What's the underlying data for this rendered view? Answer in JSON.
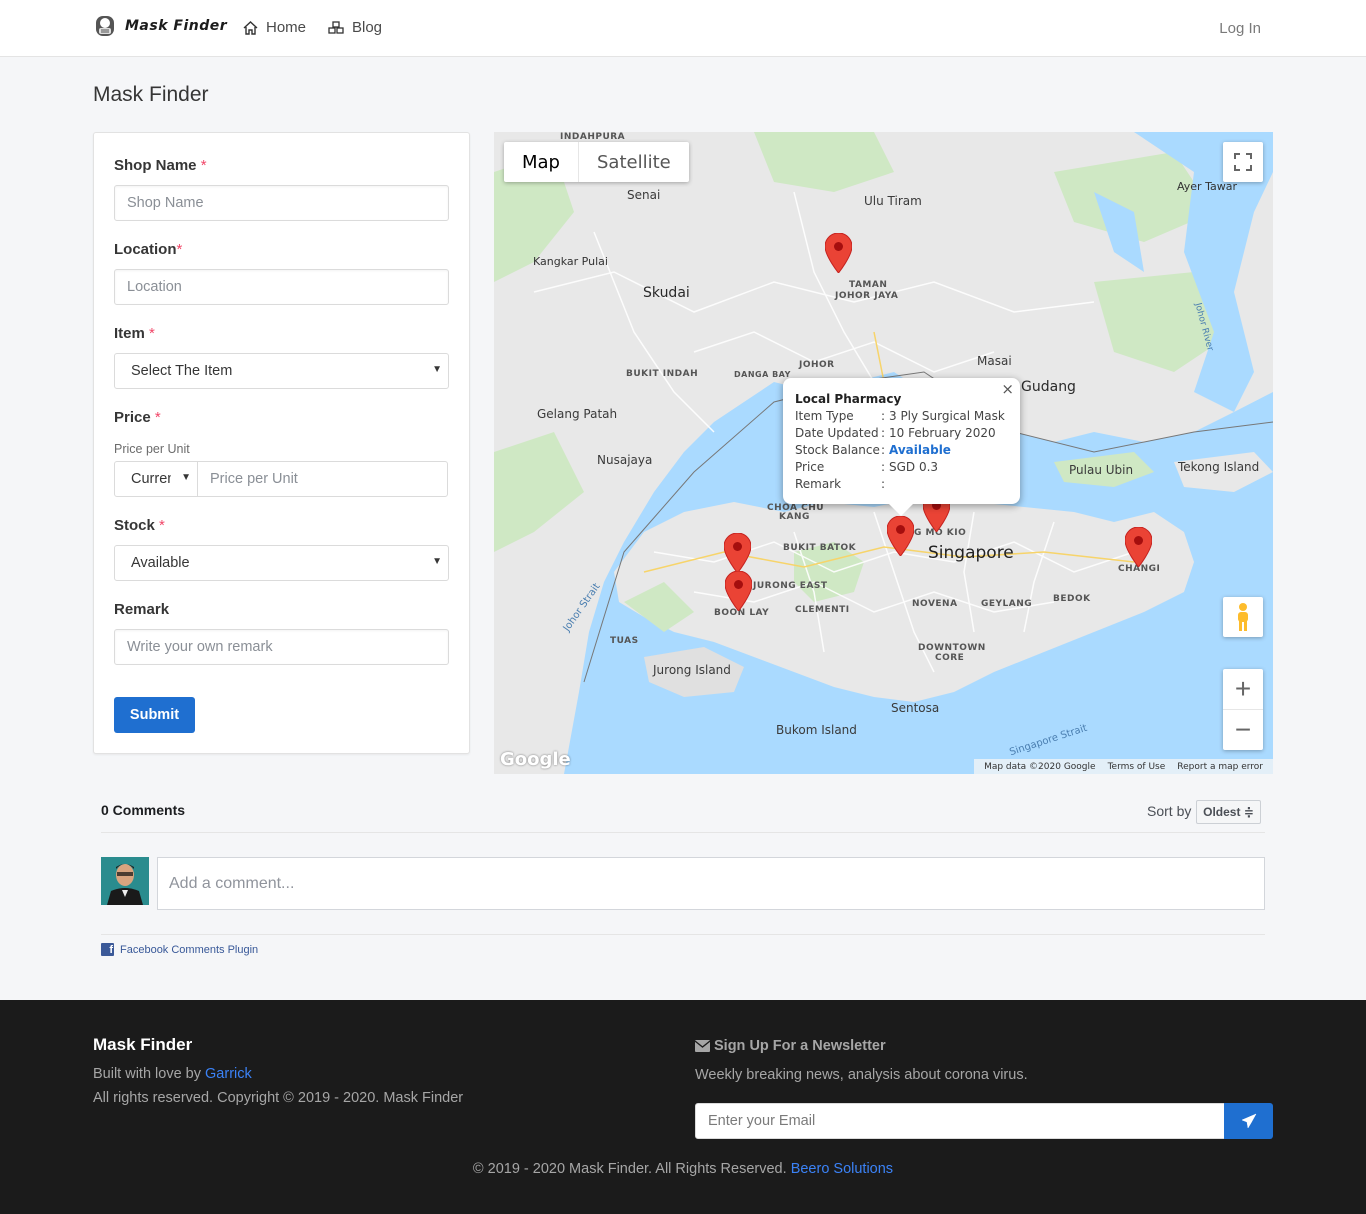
{
  "nav": {
    "brand": "Mask Finder",
    "home": "Home",
    "blog": "Blog",
    "login": "Log In"
  },
  "page_title": "Mask Finder",
  "form": {
    "shop_name": {
      "label": "Shop Name",
      "required": "*",
      "placeholder": "Shop Name"
    },
    "location": {
      "label": "Location",
      "required": "*",
      "placeholder": "Location"
    },
    "item": {
      "label": "Item",
      "required": "*",
      "selected": "Select The Item"
    },
    "price": {
      "label": "Price",
      "required": "*",
      "help": "Price per Unit",
      "currency": "Currency",
      "placeholder": "Price per Unit"
    },
    "stock": {
      "label": "Stock",
      "required": "*",
      "selected": "Available"
    },
    "remark": {
      "label": "Remark",
      "placeholder": "Write your own remark"
    },
    "submit": "Submit"
  },
  "map": {
    "type_map": "Map",
    "type_satellite": "Satellite",
    "labels": {
      "indahpura": "INDAHPURA",
      "senai": "Senai",
      "ulu_tiram": "Ulu Tiram",
      "ayer_tawar": "Ayer Tawar",
      "kangkar_pulai": "Kangkar Pulai",
      "skudai": "Skudai",
      "taman": "TAMAN",
      "johor_jaya": "JOHOR JAYA",
      "johor": "JOHOR",
      "masai": "Masai",
      "bukit_indah": "BUKIT INDAH",
      "danga_bay": "DANGA BAY",
      "gudang": "Gudang",
      "gelang_patah": "Gelang Patah",
      "nusajaya": "Nusajaya",
      "pulau_ubin": "Pulau Ubin",
      "tekong": "Tekong Island",
      "choa_chu": "CHOA CHU",
      "kang": "KANG",
      "ang_mo_kio": "NG MO KIO",
      "singapore": "Singapore",
      "changi": "CHANGI",
      "bukit_batok": "BUKIT BATOK",
      "jurong_east": "JURONG EAST",
      "boon_lay": "BOON LAY",
      "clementi": "CLEMENTI",
      "novena": "NOVENA",
      "geylang": "GEYLANG",
      "bedok": "BEDOK",
      "tuas": "TUAS",
      "downtown": "DOWNTOWN",
      "core": "CORE",
      "jurong_island": "Jurong Island",
      "sentosa": "Sentosa",
      "bukom": "Bukom Island",
      "johor_strait": "Johor Strait",
      "singapore_strait": "Singapore Strait",
      "johor_river": "Johor River"
    },
    "info": {
      "title": "Local Pharmacy",
      "rows": [
        {
          "key": "Item Type",
          "value": "3 Ply Surgical Mask"
        },
        {
          "key": "Date Updated",
          "value": "10 February 2020"
        },
        {
          "key": "Stock Balance",
          "value": "Available"
        },
        {
          "key": "Price",
          "value": "SGD 0.3"
        },
        {
          "key": "Remark",
          "value": ""
        }
      ],
      "close": "×"
    },
    "google": "Google",
    "attr_data": "Map data ©2020 Google",
    "attr_terms": "Terms of Use",
    "attr_report": "Report a map error"
  },
  "comments": {
    "count": "0 Comments",
    "sort_by": "Sort by",
    "sort_value": "Oldest ≑",
    "placeholder": "Add a comment...",
    "plugin": "Facebook Comments Plugin"
  },
  "footer": {
    "brand": "Mask Finder",
    "built": "Built with love by ",
    "author": "Garrick",
    "rights": "All rights reserved. Copyright © 2019 - 2020. Mask Finder",
    "nl_title": "Sign Up For a Newsletter",
    "nl_desc": "Weekly breaking news, analysis about corona virus.",
    "nl_placeholder": "Enter your Email",
    "copy": "© 2019 - 2020 Mask Finder. All Rights Reserved. ",
    "company": "Beero Solutions"
  }
}
